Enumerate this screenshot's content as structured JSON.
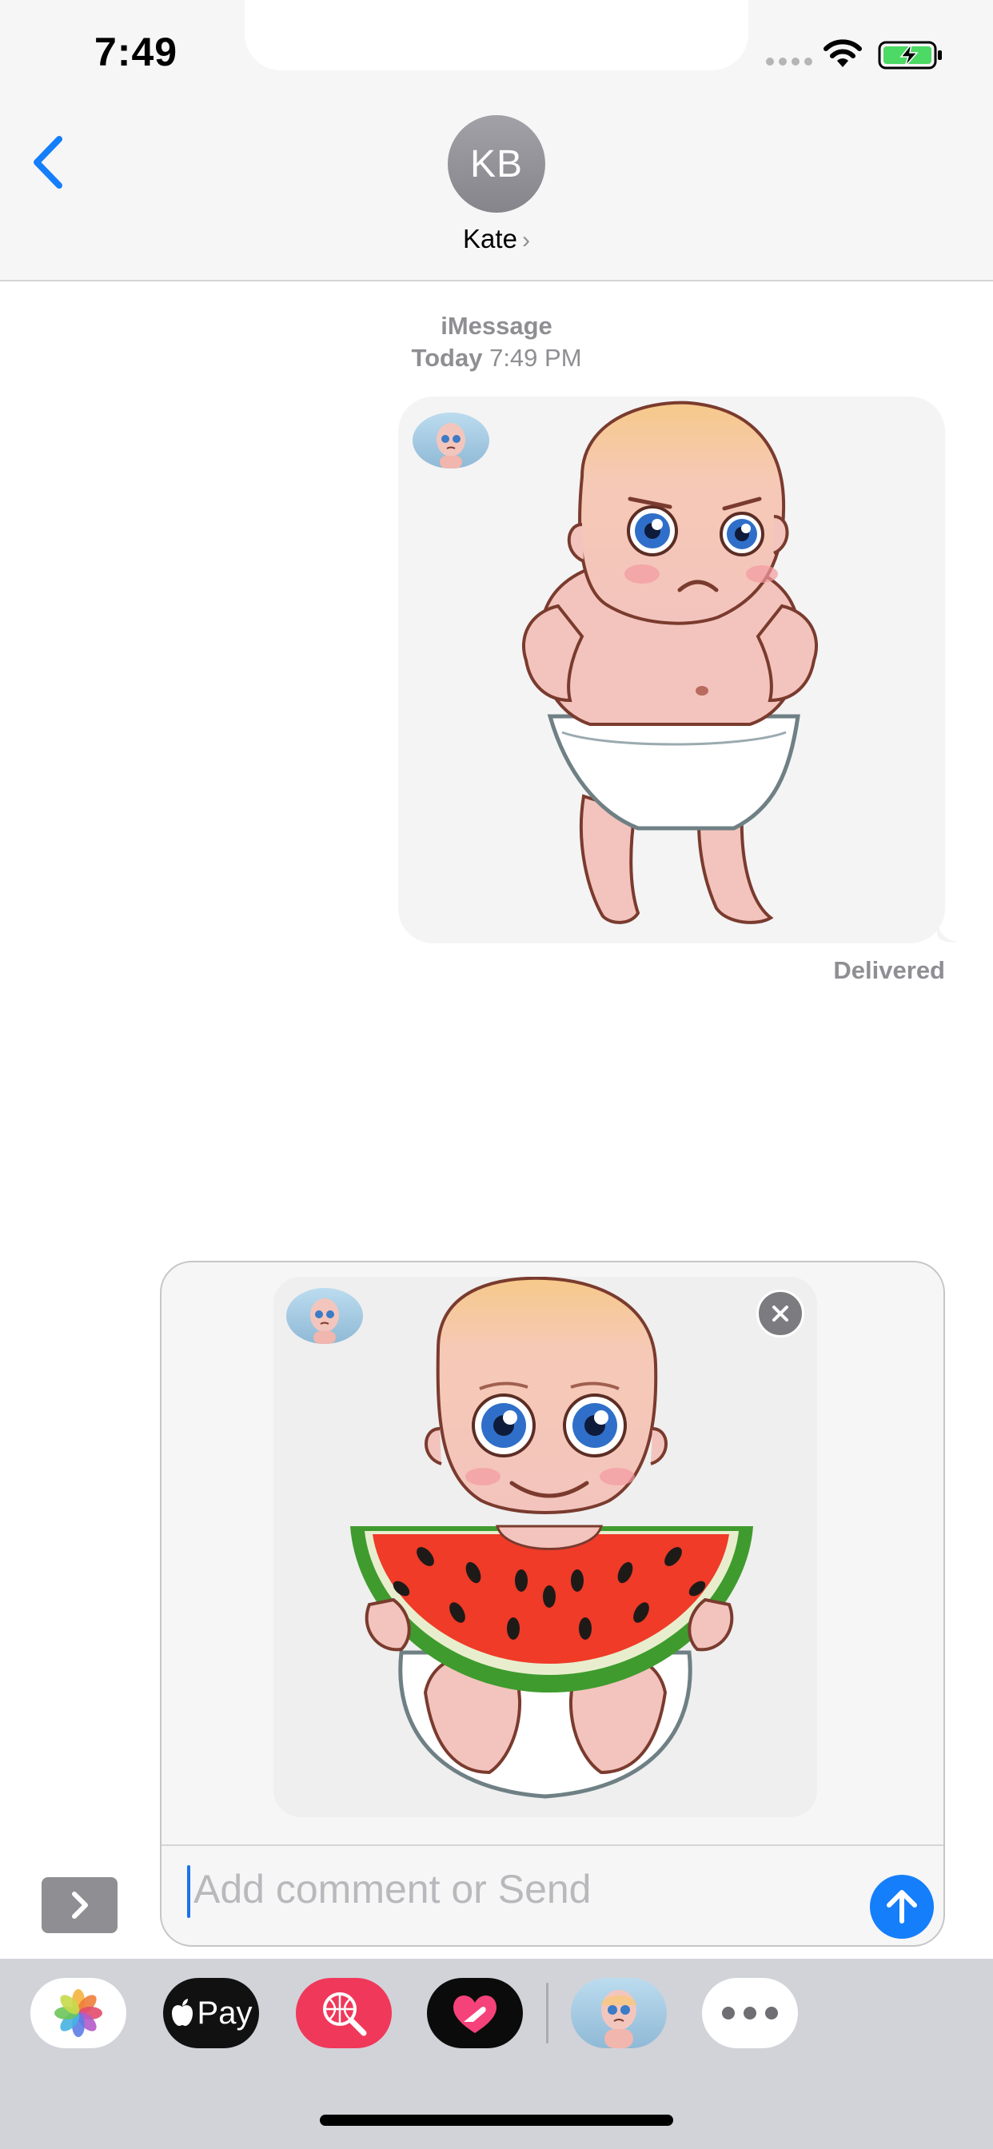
{
  "status_bar": {
    "time": "7:49"
  },
  "header": {
    "avatar_initials": "KB",
    "contact_name": "Kate"
  },
  "conversation": {
    "service": "iMessage",
    "timestamp_day": "Today",
    "timestamp_time": "7:49 PM",
    "sent_sticker": "grumpy-baby-sticker",
    "status": "Delivered"
  },
  "composer": {
    "staged_sticker": "baby-eating-watermelon-sticker",
    "placeholder": "Add comment or Send"
  },
  "app_drawer": {
    "items": [
      {
        "name": "photos",
        "icon": "photos-icon"
      },
      {
        "name": "apple-pay",
        "label": "Pay",
        "icon": "apple-logo-icon"
      },
      {
        "name": "search-images",
        "icon": "globe-search-icon"
      },
      {
        "name": "digital-touch",
        "icon": "heart-hand-icon"
      },
      {
        "name": "baby-stickers",
        "icon": "baby-sticker-icon"
      },
      {
        "name": "more",
        "icon": "more-icon"
      }
    ]
  },
  "colors": {
    "accent": "#147efb",
    "background": "#ffffff",
    "bar": "#f6f6f6",
    "drawer": "#d1d3d9",
    "secondary_text": "#8e8e93"
  }
}
